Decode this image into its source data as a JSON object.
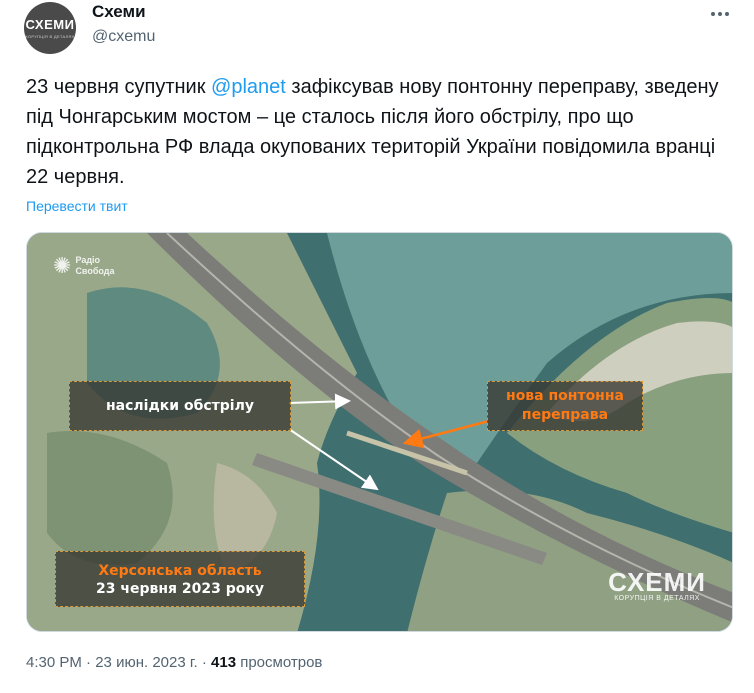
{
  "author": {
    "name": "Схеми",
    "handle": "@cxemu",
    "avatar_text": "СХЕМИ",
    "avatar_subtext": "КОРУПЦІЯ В ДЕТАЛЯХ"
  },
  "tweet": {
    "text_before": "23 червня супутник ",
    "mention": "@planet",
    "text_after": " зафіксував нову понтонну переправу, зведену під Чонгарським мостом – це сталось після його обстрілу, про що підконтрольна РФ влада окупованих територій України повідомила вранці 22 червня.",
    "translate_label": "Перевести твит"
  },
  "image": {
    "watermark_rs_line1": "Радіо",
    "watermark_rs_line2": "Свобода",
    "label_damage": "наслідки обстрілу",
    "label_new_line1": "нова понтонна",
    "label_new_line2": "переправа",
    "label_region": "Херсонська область",
    "label_date": "23 червня 2023 року",
    "watermark_schemes": "СХЕМИ",
    "watermark_schemes_sub": "КОРУПЦІЯ В ДЕТАЛЯХ",
    "colors": {
      "accent_orange": "#ff7a12",
      "water": "#3f6f6e",
      "land": "#9aa88a"
    }
  },
  "meta": {
    "time": "4:30 PM",
    "separator": "·",
    "date": "23 июн. 2023 г.",
    "views_count": "413",
    "views_label": "просмотров"
  },
  "icons": {
    "more": "more-icon"
  }
}
